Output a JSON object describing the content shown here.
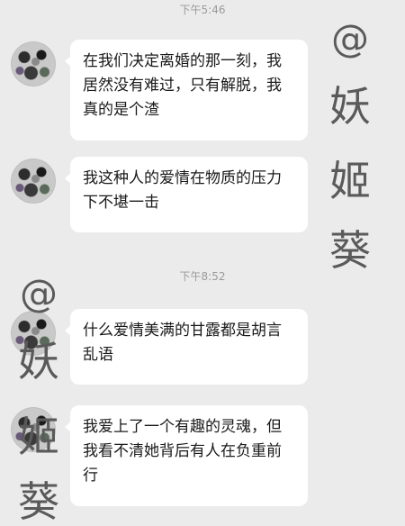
{
  "timestamps": [
    "下午5:46",
    "下午8:52"
  ],
  "messages": [
    {
      "text": "在我们决定离婚的那一刻，我居然没有难过，只有解脱，我真的是个渣"
    },
    {
      "text": "我这种人的爱情在物质的压力下不堪一击"
    },
    {
      "text": "什么爱情美满的甘露都是胡言乱语"
    },
    {
      "text": "我爱上了一个有趣的灵魂，但我看不清她背后有人在负重前行"
    }
  ],
  "watermark_right": [
    "@",
    "妖",
    "姬",
    "葵"
  ],
  "watermark_left": [
    "@",
    "妖",
    "姬",
    "葵"
  ],
  "colors": {
    "background": "#ebebeb",
    "bubble": "#ffffff",
    "timestamp": "#9a9a9a",
    "watermark": "#5a5a5a"
  }
}
